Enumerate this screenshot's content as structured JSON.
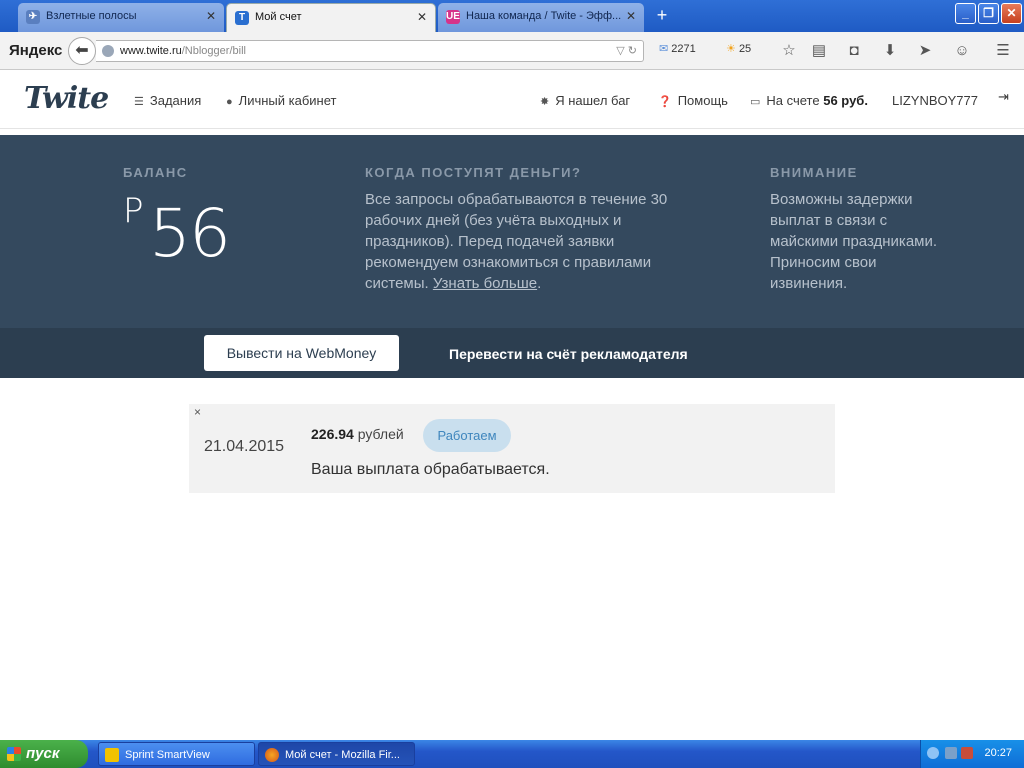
{
  "browser": {
    "tabs": [
      {
        "title": "Взлетные полосы",
        "active": false
      },
      {
        "title": "Мой счет",
        "active": true
      },
      {
        "title": "Наша команда / Twite - Эфф...",
        "active": false
      }
    ],
    "url_domain": "www.twite.ru",
    "url_path": "/Nblogger/bill",
    "yandex_logo": "Яндекс",
    "mail_count": "2271",
    "weather": "25"
  },
  "site": {
    "logo": "Twite",
    "nav": {
      "tasks": "Задания",
      "cabinet": "Личный кабинет",
      "bug": "Я нашел баг",
      "help": "Помощь",
      "balance_prefix": "На счете",
      "balance_value": "56 руб.",
      "username": "LIZYNBOY777"
    }
  },
  "balance": {
    "title": "БАЛАНС",
    "currency": "Р",
    "amount": "56"
  },
  "when_money": {
    "title": "КОГДА ПОСТУПЯТ ДЕНЬГИ?",
    "text": "Все запросы обрабатываются в течение 30 рабочих дней (без учёта выходных и праздников). Перед подачей заявки рекомендуем ознакомиться с правилами системы. ",
    "link": "Узнать больше",
    "after_link": "."
  },
  "attention": {
    "title": "ВНИМАНИЕ",
    "text": "Возможны задержки выплат в связи с майскими праздниками. Приносим свои извинения."
  },
  "actions": {
    "webmoney": "Вывести на WebMoney",
    "transfer": "Перевести на счёт рекламодателя"
  },
  "payout": {
    "close": "×",
    "date": "21.04.2015",
    "amount": "226.94",
    "unit": "рублей",
    "status": "Работаем",
    "message": "Ваша выплата обрабатывается."
  },
  "taskbar": {
    "start": "пуск",
    "tasks": [
      "Sprint SmartView",
      "Мой счет - Mozilla Fir..."
    ],
    "clock": "20:27"
  }
}
